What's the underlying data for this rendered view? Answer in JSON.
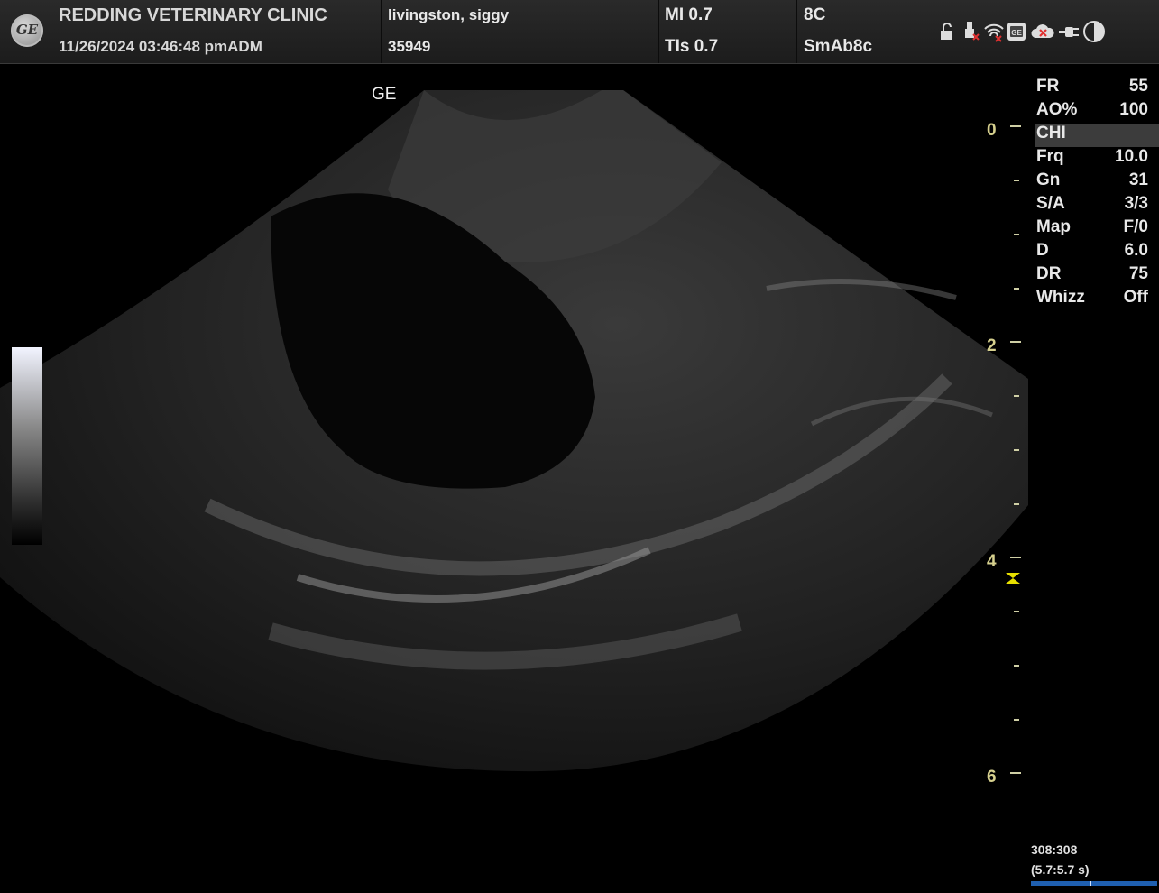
{
  "header": {
    "logo": "GE",
    "institution": "REDDING VETERINARY CLINIC",
    "datetime": "11/26/2024 03:46:48 pmADM",
    "patient_name": "livingston, siggy",
    "patient_id": "35949",
    "mi": "MI 0.7",
    "tis": "TIs 0.7",
    "probe": "8C",
    "preset": "SmAb8c"
  },
  "status_icons": [
    "lock-icon",
    "usb-icon",
    "wifi-icon",
    "network-icon",
    "cloud-icon",
    "power-plug-icon",
    "contrast-icon"
  ],
  "image": {
    "orientation_label": "GE",
    "depth_scale": [
      "0",
      "2",
      "4",
      "6"
    ]
  },
  "parameters": [
    {
      "label": "FR",
      "value": "55"
    },
    {
      "label": "AO%",
      "value": "100"
    },
    {
      "label": "CHI",
      "value": ""
    },
    {
      "label": "Frq",
      "value": "10.0"
    },
    {
      "label": "Gn",
      "value": "31"
    },
    {
      "label": "S/A",
      "value": "3/3"
    },
    {
      "label": "Map",
      "value": "F/0"
    },
    {
      "label": "D",
      "value": "6.0"
    },
    {
      "label": "DR",
      "value": "75"
    },
    {
      "label": "Whizz",
      "value": "Off"
    }
  ],
  "cine": {
    "frames": "308:308",
    "time": "(5.7:5.7 s)"
  },
  "colors": {
    "scale_label": "#d6d08e",
    "focus_marker": "#e8e000",
    "cine_bar": "#1f5fb0"
  }
}
